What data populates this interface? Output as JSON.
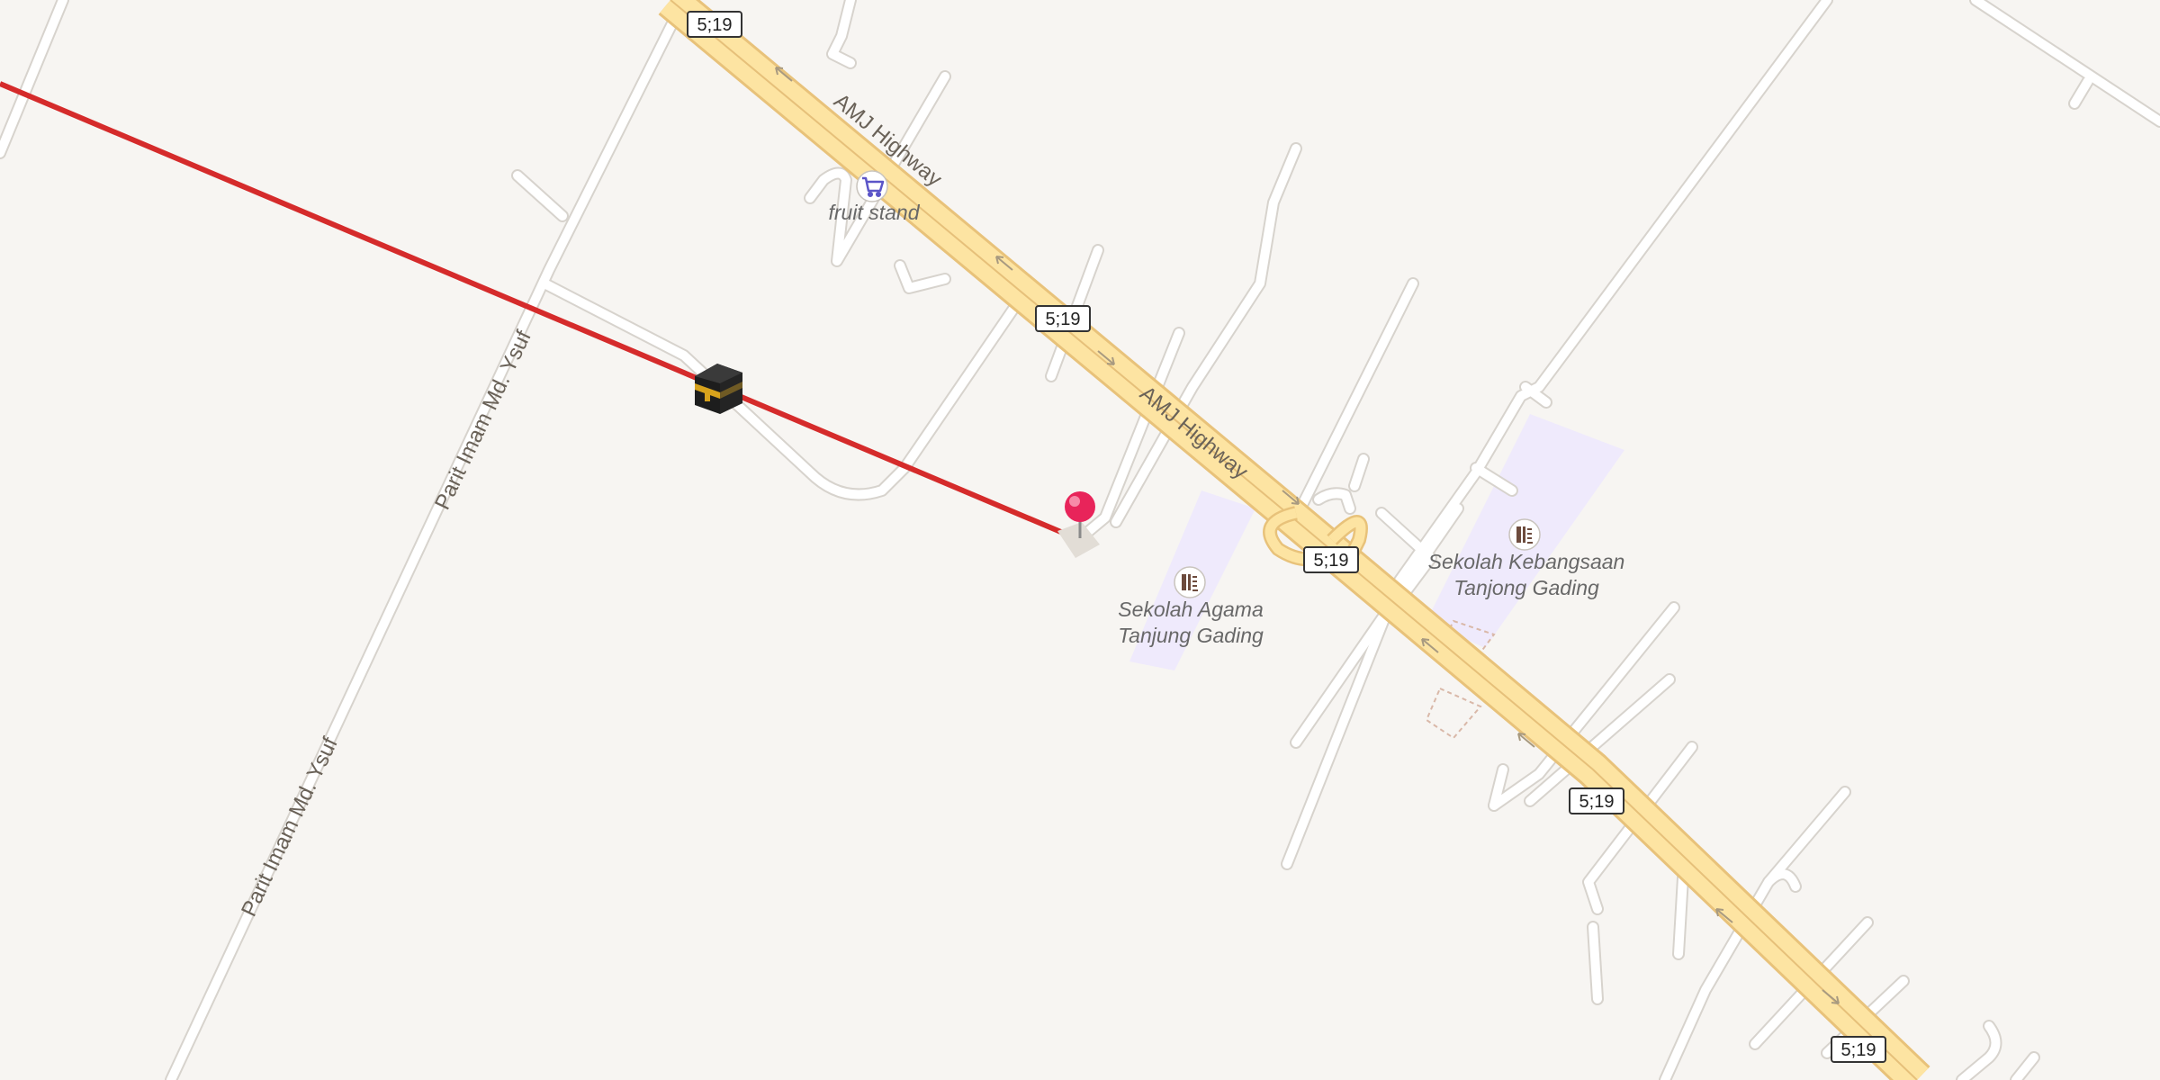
{
  "map": {
    "background": "#f7f5f2",
    "colors": {
      "highway_fill": "#fde4a2",
      "highway_casing": "#e8c27a",
      "minor_road": "#ffffff",
      "minor_road_casing": "#d7d3cd",
      "school_area": "#efeafc",
      "qibla_line": "#d52b2b",
      "pin": "#e8245a"
    },
    "highway": {
      "name": "AMJ Highway",
      "route_ref": "5;19"
    },
    "route_shields": [
      "5;19",
      "5;19",
      "5;19",
      "5;19",
      "5;19"
    ],
    "road_labels": {
      "highway_upper": "AMJ Highway",
      "highway_lower": "AMJ Highway",
      "parit_upper": "Parit Imam Md. Ysuf",
      "parit_lower": "Parit Imam Md. Ysuf"
    },
    "pois": {
      "fruit_stand": {
        "name": "fruit stand",
        "icon": "shopping-cart-icon"
      },
      "school_agama": {
        "line1": "Sekolah Agama",
        "line2": "Tanjung Gading",
        "icon": "school-icon"
      },
      "school_kebangsaan": {
        "line1": "Sekolah Kebangsaan",
        "line2": "Tanjong Gading",
        "icon": "school-icon"
      }
    },
    "markers": {
      "kaaba": {
        "icon": "kaaba-icon"
      },
      "location_pin": {
        "icon": "map-pin-icon"
      }
    }
  }
}
